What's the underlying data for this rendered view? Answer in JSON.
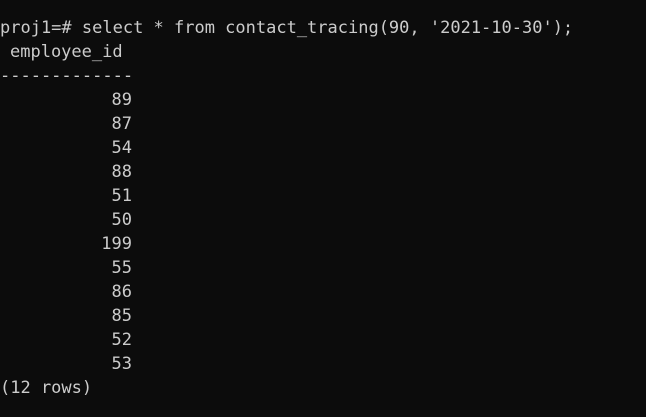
{
  "terminal": {
    "prompt": "proj1=#",
    "command": " select * from contact_tracing(90, '2021-10-30');",
    "column_header": "employee_id",
    "separator": "-------------",
    "rows": [
      "89",
      "87",
      "54",
      "88",
      "51",
      "50",
      "199",
      "55",
      "86",
      "85",
      "52",
      "53"
    ],
    "footer": "(12 rows)",
    "colors": {
      "background": "#0c0c0c",
      "foreground": "#cccccc"
    }
  }
}
